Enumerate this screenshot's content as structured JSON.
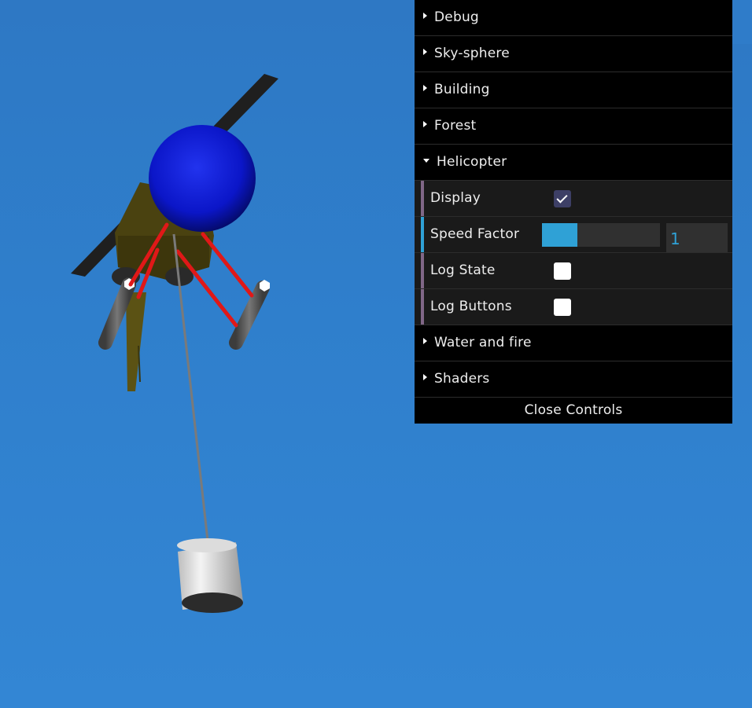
{
  "gui": {
    "folders_top": [
      {
        "label": "Debug"
      },
      {
        "label": "Sky-sphere"
      },
      {
        "label": "Building"
      },
      {
        "label": "Forest"
      }
    ],
    "helicopter": {
      "label": "Helicopter",
      "display": {
        "label": "Display",
        "checked": true
      },
      "speed_factor": {
        "label": "Speed Factor",
        "value": "1",
        "fill_fraction": 0.3
      },
      "log_state": {
        "label": "Log State",
        "checked": false
      },
      "log_buttons": {
        "label": "Log Buttons",
        "checked": false
      }
    },
    "folders_bottom": [
      {
        "label": "Water and fire"
      },
      {
        "label": "Shaders"
      }
    ],
    "close_label": "Close Controls"
  },
  "colors": {
    "sky": "#2f7cc9",
    "gui_bg": "#000000",
    "row_bg": "#1a1a1a",
    "number_accent": "#2fa1d6",
    "boolean_accent": "#806787",
    "helicopter_cockpit": "#0b16c8",
    "helicopter_body": "#4a4210",
    "helicopter_struts": "#e01818",
    "helicopter_skids": "#555555",
    "bucket": "#e6e6e6"
  }
}
